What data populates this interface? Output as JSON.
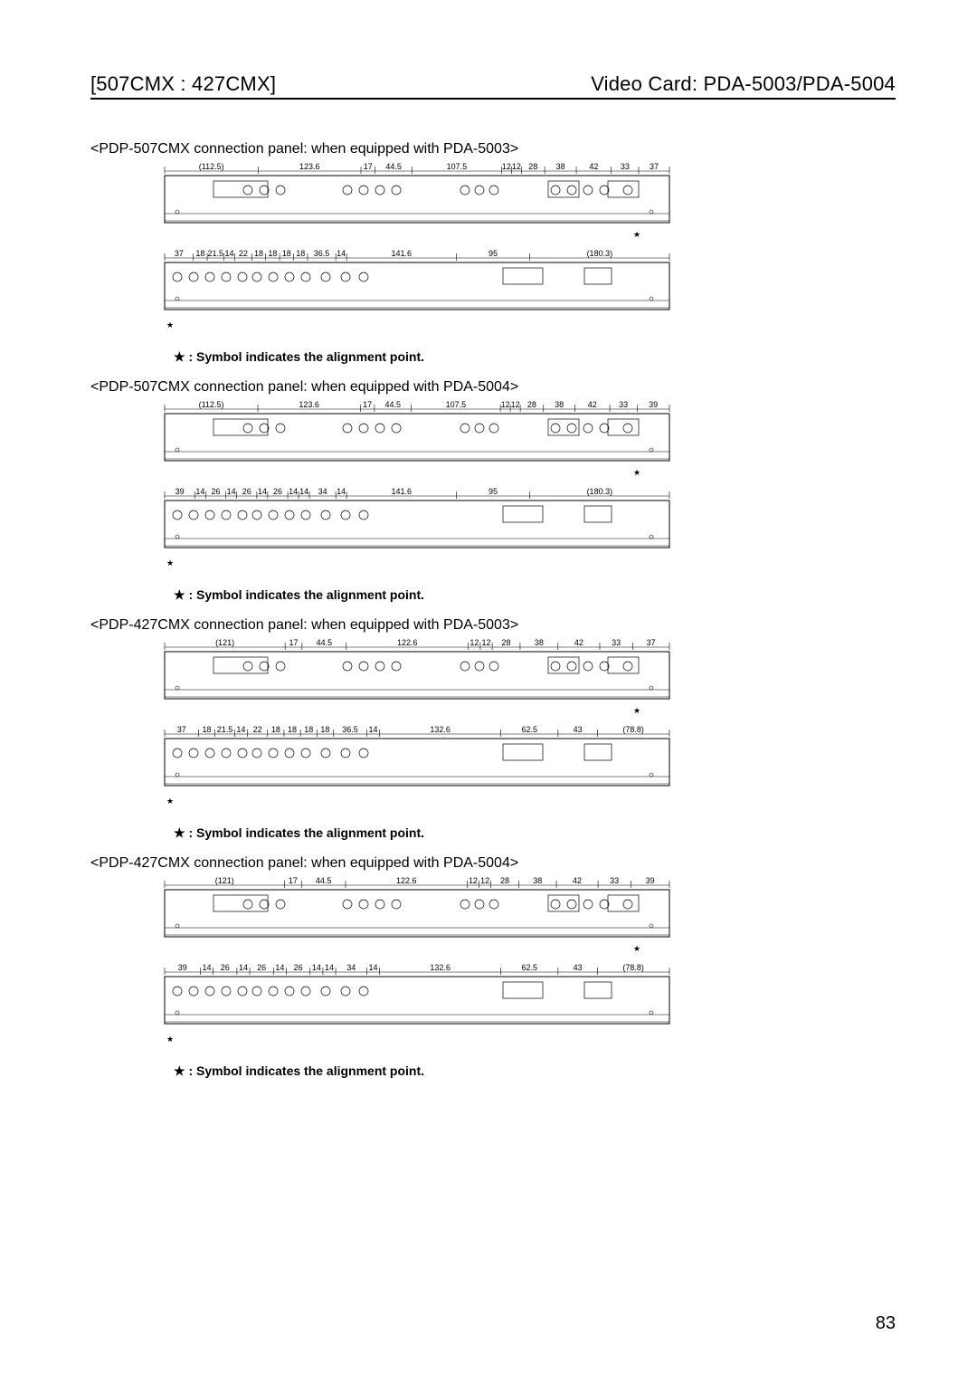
{
  "header": {
    "left": "[507CMX : 427CMX]",
    "right": "Video Card: PDA-5003/PDA-5004"
  },
  "page_number": "83",
  "note_text": ": Symbol indicates the alignment point.",
  "star_char": "★",
  "sections": [
    {
      "title": "<PDP-507CMX connection panel: when equipped with PDA-5003>",
      "top_dims": [
        "(112.5)",
        "123.6",
        "17",
        "44.5",
        "107.5",
        "12",
        "12",
        "28",
        "38",
        "42",
        "33",
        "37"
      ],
      "bottom_dims": [
        "37",
        "18",
        "21.5",
        "14",
        "22",
        "18",
        "18",
        "18",
        "18",
        "36.5",
        "14",
        "141.6",
        "95",
        "(180.3)"
      ]
    },
    {
      "title": "<PDP-507CMX connection panel: when equipped with PDA-5004>",
      "top_dims": [
        "(112.5)",
        "123.6",
        "17",
        "44.5",
        "107.5",
        "12",
        "12",
        "28",
        "38",
        "42",
        "33",
        "39"
      ],
      "bottom_dims": [
        "39",
        "14",
        "26",
        "14",
        "26",
        "14",
        "26",
        "14",
        "14",
        "34",
        "14",
        "141.6",
        "95",
        "(180.3)"
      ]
    },
    {
      "title": "<PDP-427CMX connection panel: when equipped with PDA-5003>",
      "top_dims": [
        "(121)",
        "17",
        "44.5",
        "122.6",
        "12",
        "12",
        "28",
        "38",
        "42",
        "33",
        "37"
      ],
      "bottom_dims": [
        "37",
        "18",
        "21.5",
        "14",
        "22",
        "18",
        "18",
        "18",
        "18",
        "36.5",
        "14",
        "132.6",
        "62.5",
        "43",
        "(78.8)"
      ]
    },
    {
      "title": "<PDP-427CMX connection panel: when equipped with PDA-5004>",
      "top_dims": [
        "(121)",
        "17",
        "44.5",
        "122.6",
        "12",
        "12",
        "28",
        "38",
        "42",
        "33",
        "39"
      ],
      "bottom_dims": [
        "39",
        "14",
        "26",
        "14",
        "26",
        "14",
        "26",
        "14",
        "14",
        "34",
        "14",
        "132.6",
        "62.5",
        "43",
        "(78.8)"
      ]
    }
  ]
}
